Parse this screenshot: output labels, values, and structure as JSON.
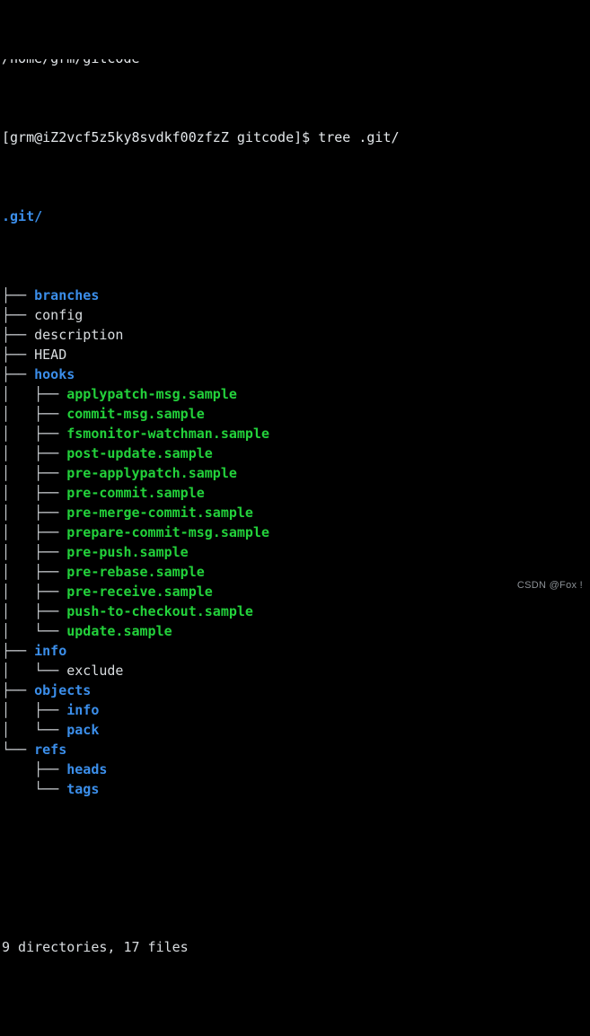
{
  "terminal": {
    "scrollback_partial_line": "/home/grm/gitcode",
    "prompt_line": "[grm@iZ2vcf5z5ky8svdkf00zfzZ gitcode]$ tree .git/",
    "prompt": {
      "user": "grm",
      "host": "iZ2vcf5z5ky8svdkf00zfzZ",
      "cwd": "gitcode",
      "symbol": "$",
      "command": "tree .git/"
    },
    "root_label": ".git/",
    "summary": "9 directories, 17 files",
    "directories_count": "9",
    "files_count": "17",
    "watermark": "CSDN @Fox !",
    "colors": {
      "background": "#000000",
      "foreground": "#d9dde0",
      "directory": "#3b8eea",
      "executable": "#23d13b",
      "guide": "#c8ccd0",
      "watermark": "#8b9095"
    },
    "tree_rows": [
      {
        "guide": "├── ",
        "name": "branches",
        "kind": "dir"
      },
      {
        "guide": "├── ",
        "name": "config",
        "kind": "file"
      },
      {
        "guide": "├── ",
        "name": "description",
        "kind": "file"
      },
      {
        "guide": "├── ",
        "name": "HEAD",
        "kind": "file"
      },
      {
        "guide": "├── ",
        "name": "hooks",
        "kind": "dir"
      },
      {
        "guide": "│   ├── ",
        "name": "applypatch-msg.sample",
        "kind": "exe"
      },
      {
        "guide": "│   ├── ",
        "name": "commit-msg.sample",
        "kind": "exe"
      },
      {
        "guide": "│   ├── ",
        "name": "fsmonitor-watchman.sample",
        "kind": "exe"
      },
      {
        "guide": "│   ├── ",
        "name": "post-update.sample",
        "kind": "exe"
      },
      {
        "guide": "│   ├── ",
        "name": "pre-applypatch.sample",
        "kind": "exe"
      },
      {
        "guide": "│   ├── ",
        "name": "pre-commit.sample",
        "kind": "exe"
      },
      {
        "guide": "│   ├── ",
        "name": "pre-merge-commit.sample",
        "kind": "exe"
      },
      {
        "guide": "│   ├── ",
        "name": "prepare-commit-msg.sample",
        "kind": "exe"
      },
      {
        "guide": "│   ├── ",
        "name": "pre-push.sample",
        "kind": "exe"
      },
      {
        "guide": "│   ├── ",
        "name": "pre-rebase.sample",
        "kind": "exe"
      },
      {
        "guide": "│   ├── ",
        "name": "pre-receive.sample",
        "kind": "exe"
      },
      {
        "guide": "│   ├── ",
        "name": "push-to-checkout.sample",
        "kind": "exe"
      },
      {
        "guide": "│   └── ",
        "name": "update.sample",
        "kind": "exe"
      },
      {
        "guide": "├── ",
        "name": "info",
        "kind": "dir"
      },
      {
        "guide": "│   └── ",
        "name": "exclude",
        "kind": "file"
      },
      {
        "guide": "├── ",
        "name": "objects",
        "kind": "dir"
      },
      {
        "guide": "│   ├── ",
        "name": "info",
        "kind": "dir"
      },
      {
        "guide": "│   └── ",
        "name": "pack",
        "kind": "dir"
      },
      {
        "guide": "└── ",
        "name": "refs",
        "kind": "dir"
      },
      {
        "guide": "    ├── ",
        "name": "heads",
        "kind": "dir"
      },
      {
        "guide": "    └── ",
        "name": "tags",
        "kind": "dir"
      }
    ]
  }
}
